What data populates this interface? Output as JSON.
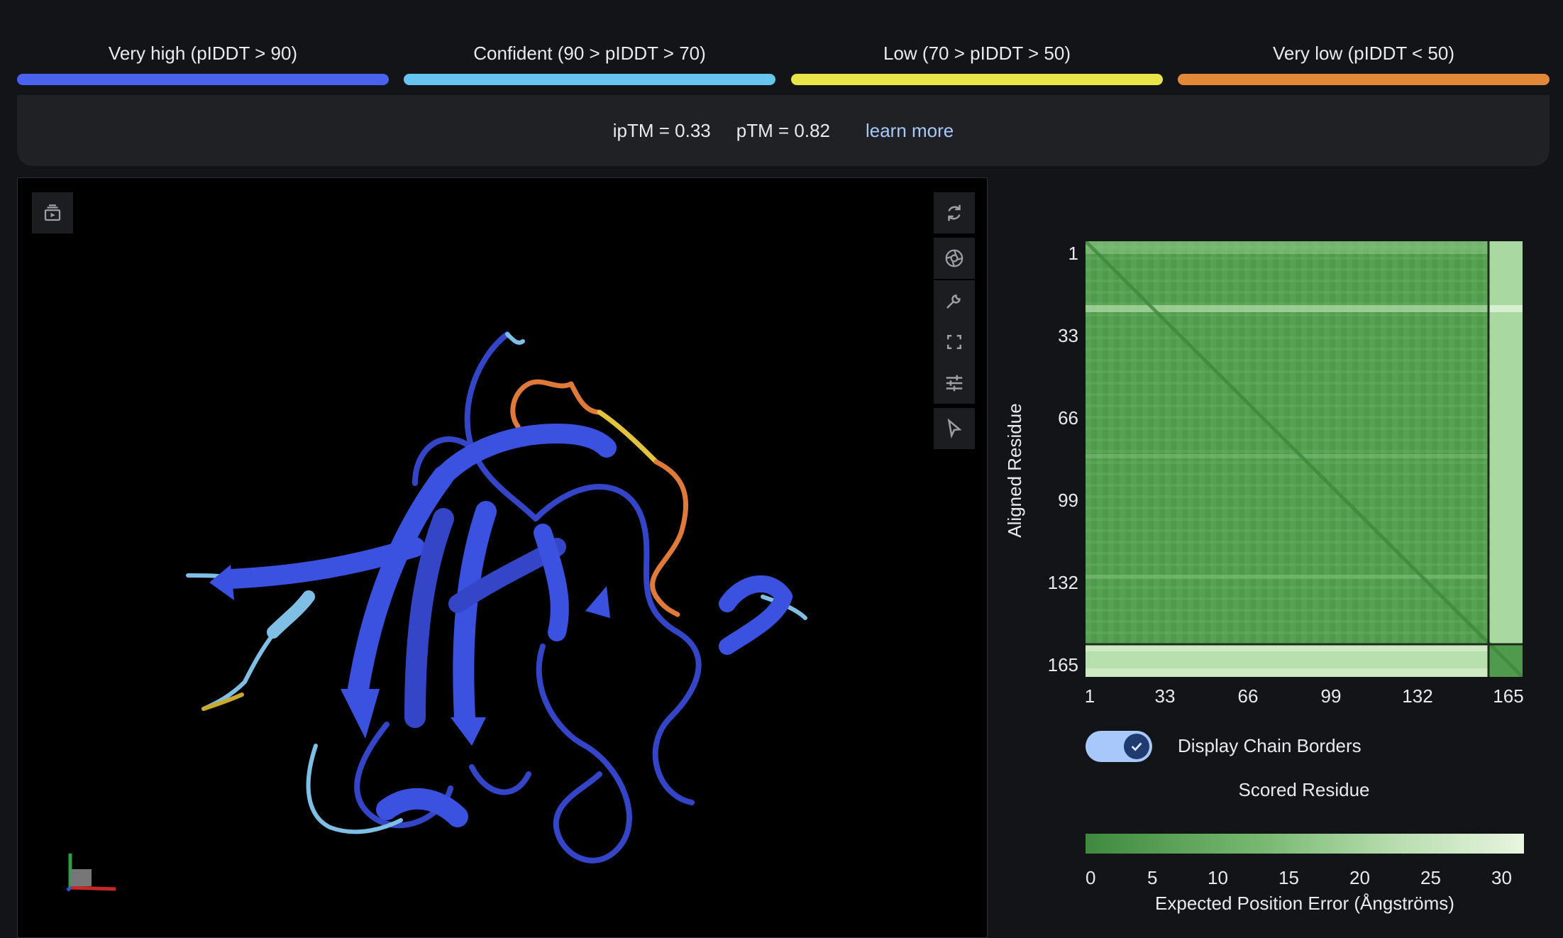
{
  "legend": [
    {
      "label": "Very high (pIDDT > 90)",
      "color": "#4a63ee"
    },
    {
      "label": "Confident (90 > pIDDT > 70)",
      "color": "#66c4ef"
    },
    {
      "label": "Low (70 > pIDDT > 50)",
      "color": "#e8e549"
    },
    {
      "label": "Very low (pIDDT < 50)",
      "color": "#e38838"
    }
  ],
  "scores": {
    "iptm": "ipTM = 0.33",
    "ptm": "pTM = 0.82",
    "learn_more": "learn more"
  },
  "viewer": {
    "tools": [
      "rotate-icon",
      "camera-icon",
      "wrench-icon",
      "fullscreen-icon",
      "sliders-icon",
      "pointer-icon"
    ],
    "left_tool": "play-queue-icon"
  },
  "pae": {
    "y_axis_label": "Aligned Residue",
    "x_axis_label": "Scored Residue",
    "ticks": [
      "1",
      "33",
      "66",
      "99",
      "132",
      "165"
    ],
    "toggle_label": "Display Chain Borders",
    "toggle_on": true,
    "colorbar_ticks": [
      "0",
      "5",
      "10",
      "15",
      "20",
      "25",
      "30"
    ],
    "colorbar_label": "Expected Position Error (Ångströms)",
    "color_low": "#2e7d32",
    "color_high": "#e8f5e0"
  }
}
